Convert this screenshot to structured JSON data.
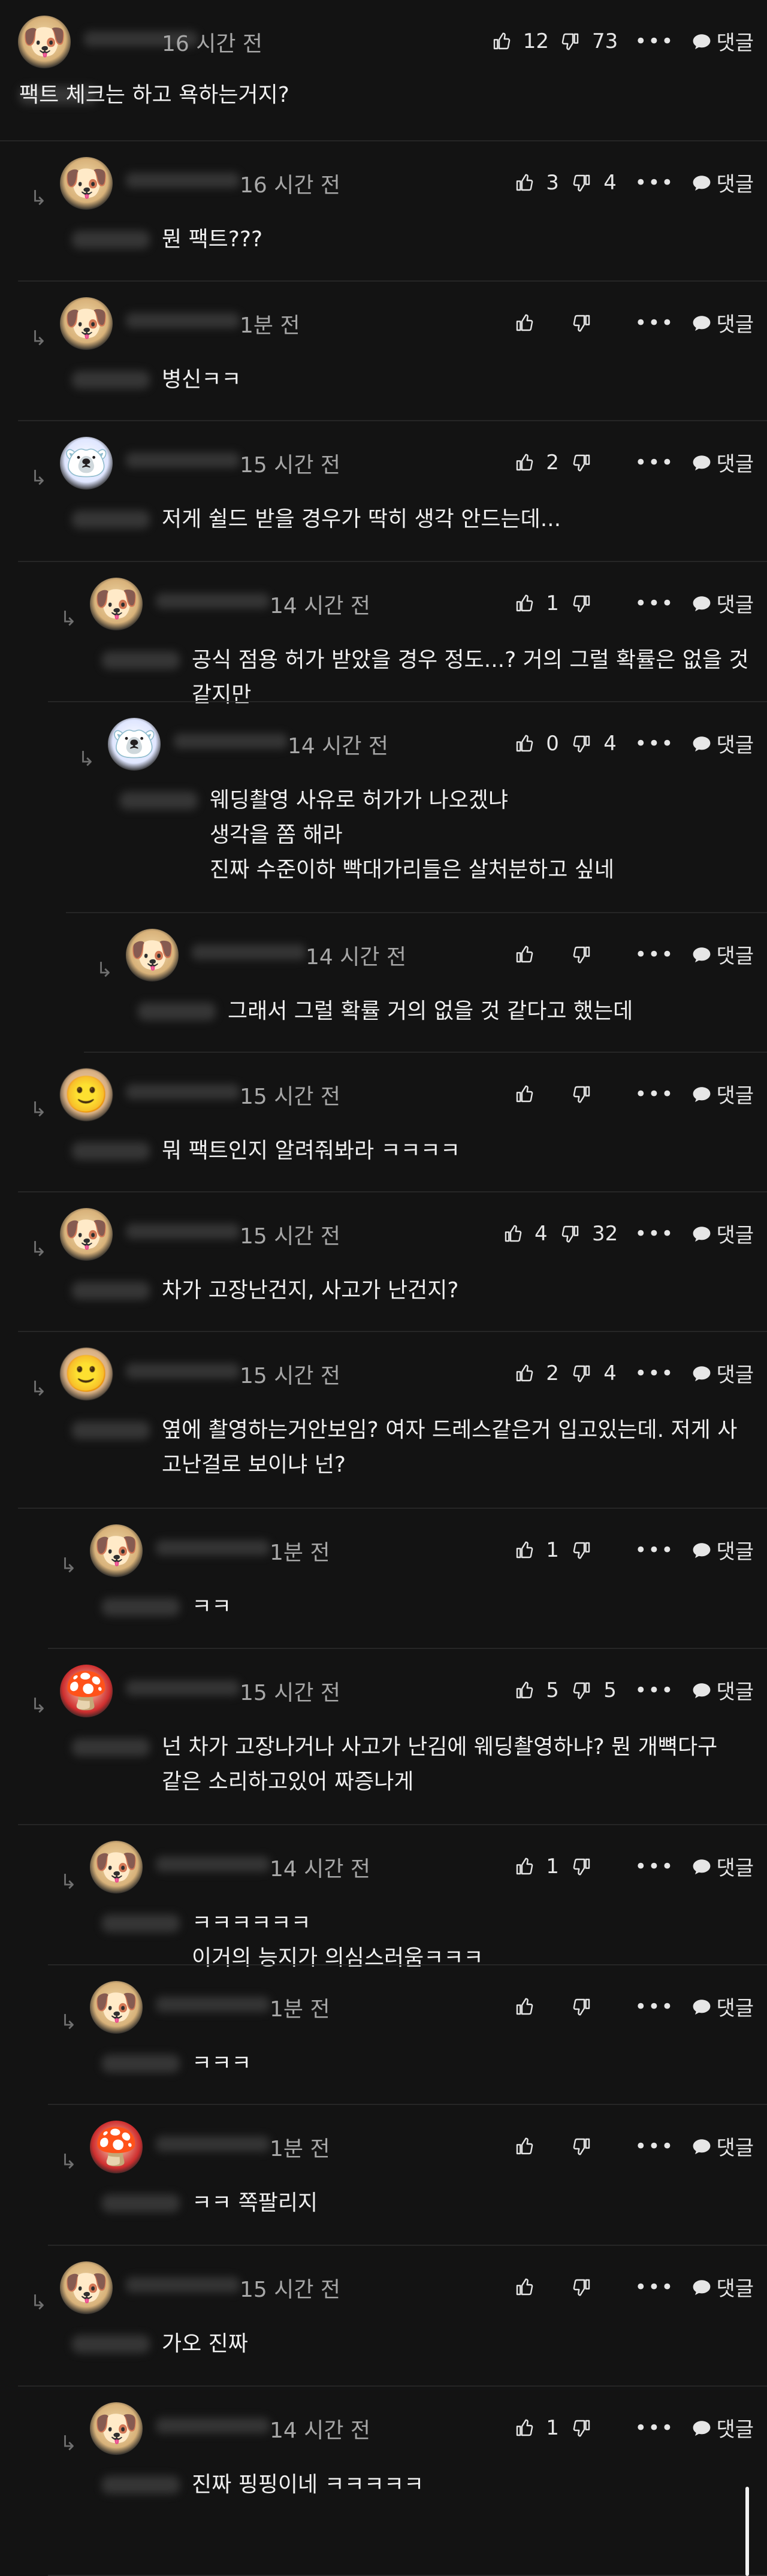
{
  "comments": [
    {
      "depth": 0,
      "avatar": "dog",
      "avatar_icon": "puppy-avatar-icon",
      "time": "16 시간 전",
      "text": "팩트 체크는 하고 욕하는거지?",
      "likes": "12",
      "dislikes": "73",
      "reply_label": "댓글"
    },
    {
      "depth": 1,
      "avatar": "dog",
      "avatar_icon": "puppy-avatar-icon",
      "time": "16 시간 전",
      "text": "뭔 팩트???",
      "likes": "3",
      "dislikes": "4",
      "reply_label": "댓글"
    },
    {
      "depth": 2,
      "avatar": "dog",
      "avatar_icon": "puppy-avatar-icon",
      "time": "1분 전",
      "text": "병신ㅋㅋ",
      "likes": "",
      "dislikes": "",
      "reply_label": "댓글"
    },
    {
      "depth": 2,
      "avatar": "bear",
      "avatar_icon": "polar-bear-avatar-icon",
      "time": "15 시간 전",
      "text": "저게 쉴드 받을 경우가 딱히 생각 안드는데...",
      "likes": "2",
      "dislikes": "",
      "reply_label": "댓글"
    },
    {
      "depth": 3,
      "avatar": "dog",
      "avatar_icon": "puppy-avatar-icon",
      "time": "14 시간 전",
      "text": "공식 점용 허가 받았을 경우 정도...? 거의 그럴 확률은 없을 것 같지만",
      "likes": "1",
      "dislikes": "",
      "reply_label": "댓글"
    },
    {
      "depth": 4,
      "avatar": "bear",
      "avatar_icon": "polar-bear-avatar-icon",
      "time": "14 시간 전",
      "text": "웨딩촬영 사유로 허가가 나오겠냐\n생각을 쫌 해라\n진짜 수준이하 빡대가리들은 살처분하고 싶네",
      "likes": "0",
      "dislikes": "4",
      "reply_label": "댓글"
    },
    {
      "depth": 5,
      "avatar": "dog",
      "avatar_icon": "puppy-avatar-icon",
      "time": "14 시간 전",
      "text": "그래서 그럴 확률 거의 없을 것 같다고 했는데",
      "likes": "",
      "dislikes": "",
      "reply_label": "댓글"
    },
    {
      "depth": 1,
      "avatar": "blur",
      "avatar_icon": "blurred-avatar-icon",
      "time": "15 시간 전",
      "text": "뭐 팩트인지 알려줘봐라 ㅋㅋㅋㅋ",
      "likes": "",
      "dislikes": "",
      "reply_label": "댓글"
    },
    {
      "depth": 1,
      "avatar": "dog",
      "avatar_icon": "puppy-avatar-icon",
      "time": "15 시간 전",
      "text": "차가 고장난건지, 사고가 난건지?",
      "likes": "4",
      "dislikes": "32",
      "reply_label": "댓글"
    },
    {
      "depth": 2,
      "avatar": "blur",
      "avatar_icon": "blurred-avatar-icon",
      "time": "15 시간 전",
      "text": "옆에 촬영하는거안보임? 여자 드레스같은거 입고있는데. 저게 사\n고난걸로 보이냐 넌?",
      "likes": "2",
      "dislikes": "4",
      "reply_label": "댓글"
    },
    {
      "depth": 3,
      "avatar": "dog",
      "avatar_icon": "puppy-avatar-icon",
      "time": "1분 전",
      "text": "ㅋㅋ",
      "likes": "1",
      "dislikes": "",
      "reply_label": "댓글"
    },
    {
      "depth": 2,
      "avatar": "mario",
      "avatar_icon": "mario-avatar-icon",
      "time": "15 시간 전",
      "text": "넌 차가 고장나거나 사고가 난김에 웨딩촬영하냐? 뭔 개뼉다구\n같은 소리하고있어 짜증나게",
      "likes": "5",
      "dislikes": "5",
      "reply_label": "댓글"
    },
    {
      "depth": 3,
      "avatar": "dog",
      "avatar_icon": "puppy-avatar-icon",
      "time": "14 시간 전",
      "text": "ㅋㅋㅋㅋㅋㅋ\n이거의 능지가 의심스러움ㅋㅋㅋ",
      "likes": "1",
      "dislikes": "",
      "reply_label": "댓글"
    },
    {
      "depth": 3,
      "avatar": "dog",
      "avatar_icon": "puppy-avatar-icon",
      "time": "1분 전",
      "text": "ㅋㅋㅋ",
      "likes": "",
      "dislikes": "",
      "reply_label": "댓글"
    },
    {
      "depth": 3,
      "avatar": "mario",
      "avatar_icon": "mario-avatar-icon",
      "time": "1분 전",
      "text": "ㅋㅋ 쪽팔리지",
      "likes": "",
      "dislikes": "",
      "reply_label": "댓글"
    },
    {
      "depth": 2,
      "avatar": "dog",
      "avatar_icon": "puppy-avatar-icon",
      "time": "15 시간 전",
      "text": "가오 진짜",
      "likes": "",
      "dislikes": "",
      "reply_label": "댓글"
    },
    {
      "depth": 3,
      "avatar": "dog",
      "avatar_icon": "puppy-avatar-icon",
      "time": "14 시간 전",
      "text": "진짜 핑핑이네 ㅋㅋㅋㅋㅋ",
      "likes": "1",
      "dislikes": "",
      "reply_label": "댓글"
    }
  ]
}
